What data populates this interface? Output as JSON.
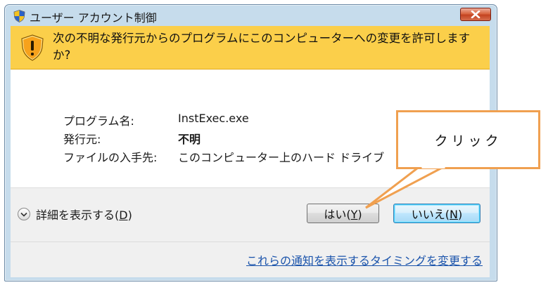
{
  "window": {
    "title": "ユーザー アカウント制御"
  },
  "header": {
    "message": "次の不明な発行元からのプログラムにこのコンピューターへの変更を許可しますか?"
  },
  "info": {
    "program_label": "プログラム名:",
    "program_value": "InstExec.exe",
    "publisher_label": "発行元:",
    "publisher_value": "不明",
    "origin_label": "ファイルの入手先:",
    "origin_value": "このコンピューター上のハード ドライブ"
  },
  "actions": {
    "details_label": "詳細を表示する(",
    "details_key": "D",
    "details_suffix": ")",
    "yes_label": "はい(",
    "yes_key": "Y",
    "yes_suffix": ")",
    "no_label": "いいえ(",
    "no_key": "N",
    "no_suffix": ")"
  },
  "footer": {
    "link": "これらの通知を表示するタイミングを変更する"
  },
  "annotation": {
    "callout_text": "クリック"
  },
  "colors": {
    "header_bg": "#fbcf4a",
    "callout_border": "#f0a050",
    "link": "#1a53ab",
    "close_button": "#c44320"
  },
  "icons": {
    "title": "uac-shield-icon",
    "header": "warning-shield-icon",
    "close": "close-icon",
    "details": "chevron-down-icon"
  }
}
